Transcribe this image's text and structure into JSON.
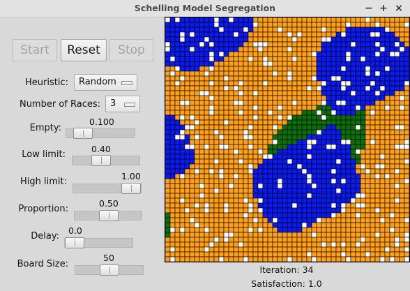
{
  "window": {
    "title": "Schelling Model Segregation",
    "minimize_icon": "minimize-icon",
    "maximize_icon": "maximize-icon",
    "close_icon": "close-icon"
  },
  "buttons": {
    "start": "Start",
    "reset": "Reset",
    "stop": "Stop"
  },
  "controls": {
    "heuristic": {
      "label": "Heuristic:",
      "value": "Random"
    },
    "races": {
      "label": "Number of Races:",
      "value": "3"
    },
    "empty": {
      "label": "Empty:",
      "value": "0.100",
      "level": 0.1
    },
    "low_limit": {
      "label": "Low limit:",
      "value": "0.40",
      "level": 0.4
    },
    "high_limit": {
      "label": "High limit:",
      "value": "1.00",
      "level": 1.0
    },
    "proportion": {
      "label": "Proportion:",
      "value": "0.50",
      "level": 0.5
    },
    "delay": {
      "label": "Delay:",
      "value": "0.0",
      "level": 0.0
    },
    "board_size": {
      "label": "Board Size:",
      "value": "50",
      "level": 0.5
    }
  },
  "board": {
    "colors": {
      "race_1": "#ff9f1a",
      "race_2": "#0b1aee",
      "race_3": "#0d6e0d",
      "empty": "#ffffff",
      "grid": "#000000"
    }
  },
  "status": {
    "iteration": "Iteration: 34",
    "satisfaction": "Satisfaction: 1.0"
  }
}
